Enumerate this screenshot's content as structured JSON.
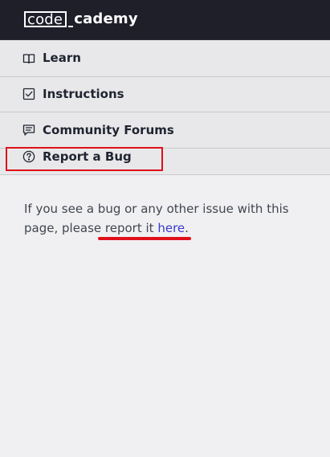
{
  "header": {
    "logo_code": "code",
    "logo_cademy": "cademy"
  },
  "menu": {
    "items": [
      {
        "label": "Learn",
        "icon": "book-icon"
      },
      {
        "label": "Instructions",
        "icon": "checkbox-icon"
      },
      {
        "label": "Community Forums",
        "icon": "chat-icon"
      },
      {
        "label": "Report a Bug",
        "icon": "question-icon"
      }
    ]
  },
  "bug_panel": {
    "text_prefix": "If you see a bug or any other issue with this page, please report it ",
    "link_text": "here",
    "text_suffix": "."
  },
  "annotations": {
    "highlight_color": "#e0101a"
  }
}
